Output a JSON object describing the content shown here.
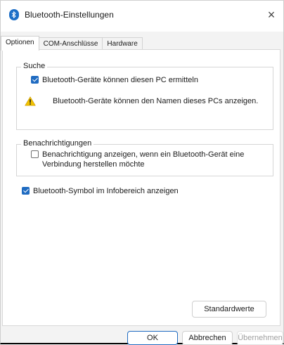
{
  "window": {
    "title": "Bluetooth-Einstellungen",
    "close_glyph": "×",
    "icon": "bluetooth-icon"
  },
  "tabs": [
    {
      "label": "Optionen",
      "active": true
    },
    {
      "label": "COM-Anschlüsse",
      "active": false
    },
    {
      "label": "Hardware",
      "active": false
    }
  ],
  "search_group": {
    "legend": "Suche",
    "discover_checkbox": {
      "label": "Bluetooth-Geräte können diesen PC ermitteln",
      "checked": true
    },
    "warning_icon": "warning-icon",
    "warning_text": "Bluetooth-Geräte können den Namen dieses PCs anzeigen."
  },
  "notifications_group": {
    "legend": "Benachrichtigungen",
    "notify_checkbox": {
      "label_line1": "Benachrichtigung anzeigen, wenn ein Bluetooth-Gerät eine",
      "label_line2": "Verbindung herstellen möchte",
      "checked": false
    }
  },
  "tray_checkbox": {
    "label": "Bluetooth-Symbol im Infobereich anzeigen",
    "checked": true
  },
  "buttons": {
    "defaults": "Standardwerte",
    "ok": "OK",
    "cancel": "Abbrechen",
    "apply": "Übernehmen"
  },
  "colors": {
    "accent": "#1f6bc1",
    "warning": "#f2c200"
  }
}
